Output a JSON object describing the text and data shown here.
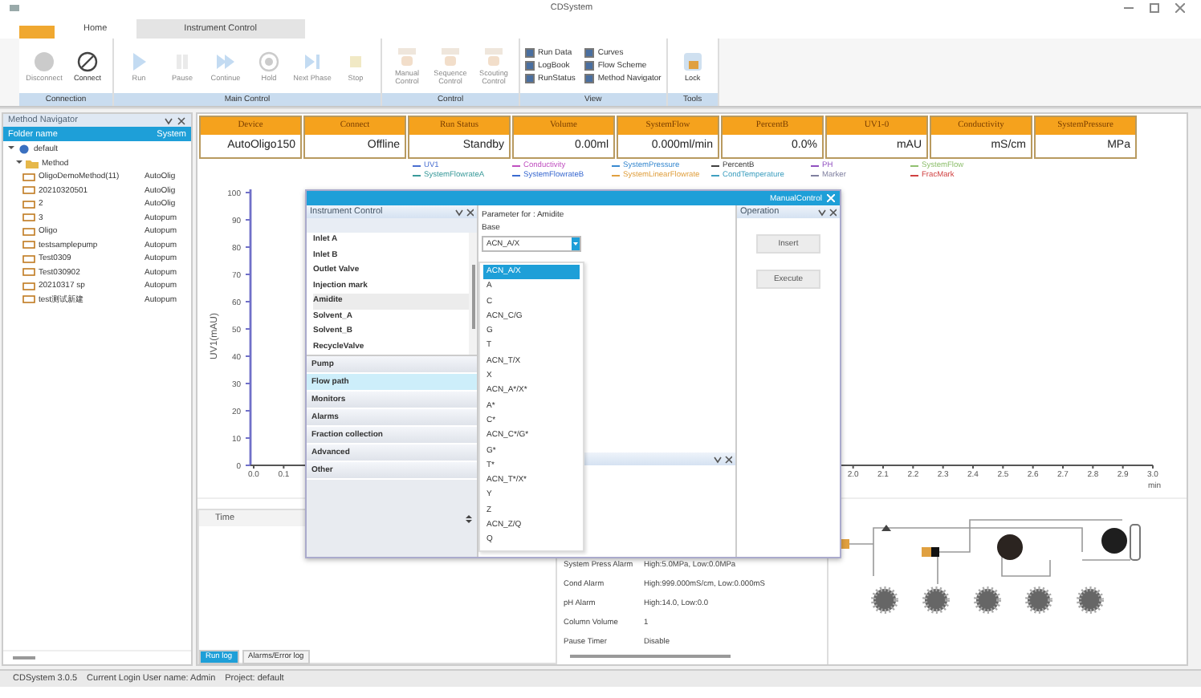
{
  "window": {
    "title": "CDSystem"
  },
  "tabs": [
    {
      "label": "Home",
      "selected": false
    },
    {
      "label": "Instrument Control",
      "selected": true
    }
  ],
  "ribbon": [
    {
      "label": "Connection",
      "buttons": [
        {
          "label": "Disconnect",
          "kind": "disconnect",
          "disabled": true
        },
        {
          "label": "Connect",
          "kind": "connect",
          "disabled": false
        }
      ]
    },
    {
      "label": "Main Control",
      "buttons": [
        {
          "label": "Run",
          "kind": "run",
          "disabled": true
        },
        {
          "label": "Pause",
          "kind": "pause",
          "disabled": true
        },
        {
          "label": "Continue",
          "kind": "continue",
          "disabled": true
        },
        {
          "label": "Hold",
          "kind": "hold",
          "disabled": true
        },
        {
          "label": "Next Phase",
          "kind": "next",
          "disabled": true
        },
        {
          "label": "Stop",
          "kind": "stop",
          "disabled": true
        }
      ]
    },
    {
      "label": "Control",
      "buttons": [
        {
          "label": "Manual Control",
          "kind": "control",
          "disabled": true
        },
        {
          "label": "Sequence Control",
          "kind": "control",
          "disabled": true
        },
        {
          "label": "Scouting Control",
          "kind": "control",
          "disabled": true
        }
      ]
    },
    {
      "label": "View",
      "checks": [
        {
          "label": "Run Data",
          "checked": true
        },
        {
          "label": "Curves",
          "checked": true
        },
        {
          "label": "LogBook",
          "checked": true
        },
        {
          "label": "Flow Scheme",
          "checked": true
        },
        {
          "label": "RunStatus",
          "checked": true
        },
        {
          "label": "Method Navigator",
          "checked": true
        }
      ]
    },
    {
      "label": "Tools",
      "buttons": [
        {
          "label": "Lock",
          "kind": "lock",
          "disabled": false
        }
      ]
    }
  ],
  "navigator": {
    "title": "Method Navigator",
    "columns": [
      "Folder name",
      "System"
    ],
    "tree": [
      {
        "label": "default",
        "expanded": true,
        "children": [
          {
            "label": "Method",
            "expanded": true,
            "children": [
              {
                "label": "OligoDemoMethod(11)",
                "system": "AutoOlig"
              },
              {
                "label": "20210320501",
                "system": "AutoOlig"
              },
              {
                "label": "2",
                "system": "AutoOlig"
              },
              {
                "label": "3",
                "system": "Autopum"
              },
              {
                "label": "Oligo",
                "system": "Autopum"
              },
              {
                "label": "testsamplepump",
                "system": "Autopum"
              },
              {
                "label": "Test0309",
                "system": "Autopum"
              },
              {
                "label": "Test030902",
                "system": "Autopum"
              },
              {
                "label": "20210317 sp",
                "system": "Autopum"
              },
              {
                "label": "test测试新建",
                "system": "Autopum"
              }
            ]
          }
        ]
      }
    ]
  },
  "status_cells": [
    {
      "label": "Device",
      "value": "AutoOligo150"
    },
    {
      "label": "Connect",
      "value": "Offline"
    },
    {
      "label": "Run Status",
      "value": "Standby"
    },
    {
      "label": "Volume",
      "value": "0.00ml"
    },
    {
      "label": "SystemFlow",
      "value": "0.000ml/min"
    },
    {
      "label": "PercentB",
      "value": "0.0%"
    },
    {
      "label": "UV1-0",
      "value": "mAU"
    },
    {
      "label": "Conductivity",
      "value": "mS/cm"
    },
    {
      "label": "SystemPressure",
      "value": "MPa"
    }
  ],
  "legend": [
    {
      "name": "UV1",
      "color": "#4a6fd0"
    },
    {
      "name": "Conductivity",
      "color": "#c050c0"
    },
    {
      "name": "SystemPressure",
      "color": "#3a8ad0"
    },
    {
      "name": "PercentB",
      "color": "#404040"
    },
    {
      "name": "PH",
      "color": "#9050c0"
    },
    {
      "name": "SystemFlow",
      "color": "#90c070"
    },
    {
      "name": "SystemFlowrateA",
      "color": "#3a9a9a"
    },
    {
      "name": "SystemFlowrateB",
      "color": "#3a6ad0"
    },
    {
      "name": "SystemLinearFlowrate",
      "color": "#e0a040"
    },
    {
      "name": "CondTemperature",
      "color": "#40a0c0"
    },
    {
      "name": "Marker",
      "color": "#8080a0"
    },
    {
      "name": "FracMark",
      "color": "#d04040"
    }
  ],
  "chart": {
    "chart_data": {
      "type": "line",
      "ylabel": "UV1(mAU)",
      "xlabel": "min",
      "xlim": [
        0,
        3
      ],
      "ylim": [
        0,
        100
      ],
      "yticks": [
        0,
        10,
        20,
        30,
        40,
        50,
        60,
        70,
        80,
        90,
        100
      ],
      "xticks": [
        {
          "value": 0,
          "label": "0.0"
        },
        {
          "value": 0.1,
          "label": "0.1"
        },
        {
          "value": 2.0,
          "label": "2.0"
        },
        {
          "value": 2.1,
          "label": "2.1"
        },
        {
          "value": 2.2,
          "label": "2.2"
        },
        {
          "value": 2.3,
          "label": "2.3"
        },
        {
          "value": 2.4,
          "label": "2.4"
        },
        {
          "value": 2.5,
          "label": "2.5"
        },
        {
          "value": 2.6,
          "label": "2.6"
        },
        {
          "value": 2.7,
          "label": "2.7"
        },
        {
          "value": 2.8,
          "label": "2.8"
        },
        {
          "value": 2.9,
          "label": "2.9"
        },
        {
          "value": 3.0,
          "label": "3.0"
        }
      ]
    }
  },
  "log": {
    "column": "Time",
    "tabs": [
      {
        "label": "Run log",
        "selected": true
      },
      {
        "label": "Alarms/Error log",
        "selected": false
      }
    ]
  },
  "properties": [
    {
      "name": "System Press Alarm",
      "value": "High:5.0MPa, Low:0.0MPa"
    },
    {
      "name": "Cond Alarm",
      "value": "High:999.000mS/cm, Low:0.000mS"
    },
    {
      "name": "pH Alarm",
      "value": "High:14.0, Low:0.0"
    },
    {
      "name": "Column Volume",
      "value": "1"
    },
    {
      "name": "Pause Timer",
      "value": "Disable"
    }
  ],
  "dialog": {
    "title": "ManualControl",
    "instrument_panel": {
      "title": "Instrument Control",
      "items": [
        {
          "label": "Inlet A",
          "selected": false
        },
        {
          "label": "Inlet B",
          "selected": false
        },
        {
          "label": "Outlet Valve",
          "selected": false
        },
        {
          "label": "Injection mark",
          "selected": false
        },
        {
          "label": "Amidite",
          "selected": true
        },
        {
          "label": "Solvent_A",
          "selected": false
        },
        {
          "label": "Solvent_B",
          "selected": false
        },
        {
          "label": "RecycleValve",
          "selected": false
        }
      ],
      "sections": [
        {
          "label": "Pump",
          "selected": false
        },
        {
          "label": "Flow path",
          "selected": true
        },
        {
          "label": "Monitors",
          "selected": false
        },
        {
          "label": "Alarms",
          "selected": false
        },
        {
          "label": "Fraction collection",
          "selected": false
        },
        {
          "label": "Advanced",
          "selected": false
        },
        {
          "label": "Other",
          "selected": false
        }
      ]
    },
    "parameter_panel": {
      "heading": "Parameter for : Amidite",
      "field_label": "Base",
      "value": "ACN_A/X",
      "options": [
        {
          "label": "ACN_A/X",
          "selected": true
        },
        {
          "label": "A",
          "selected": false
        },
        {
          "label": "C",
          "selected": false
        },
        {
          "label": "ACN_C/G",
          "selected": false
        },
        {
          "label": "G",
          "selected": false
        },
        {
          "label": "T",
          "selected": false
        },
        {
          "label": "ACN_T/X",
          "selected": false
        },
        {
          "label": "X",
          "selected": false
        },
        {
          "label": "ACN_A*/X*",
          "selected": false
        },
        {
          "label": "A*",
          "selected": false
        },
        {
          "label": "C*",
          "selected": false
        },
        {
          "label": "ACN_C*/G*",
          "selected": false
        },
        {
          "label": "G*",
          "selected": false
        },
        {
          "label": "T*",
          "selected": false
        },
        {
          "label": "ACN_T*/X*",
          "selected": false
        },
        {
          "label": "Y",
          "selected": false
        },
        {
          "label": "Z",
          "selected": false
        },
        {
          "label": "ACN_Z/Q",
          "selected": false
        },
        {
          "label": "Q",
          "selected": false
        }
      ]
    },
    "operation_panel": {
      "title": "Operation",
      "buttons": [
        "Insert",
        "Execute"
      ]
    }
  },
  "status_bar": {
    "version": "CDSystem 3.0.5",
    "user": "Current Login User name:  Admin",
    "project": "Project:  default"
  }
}
